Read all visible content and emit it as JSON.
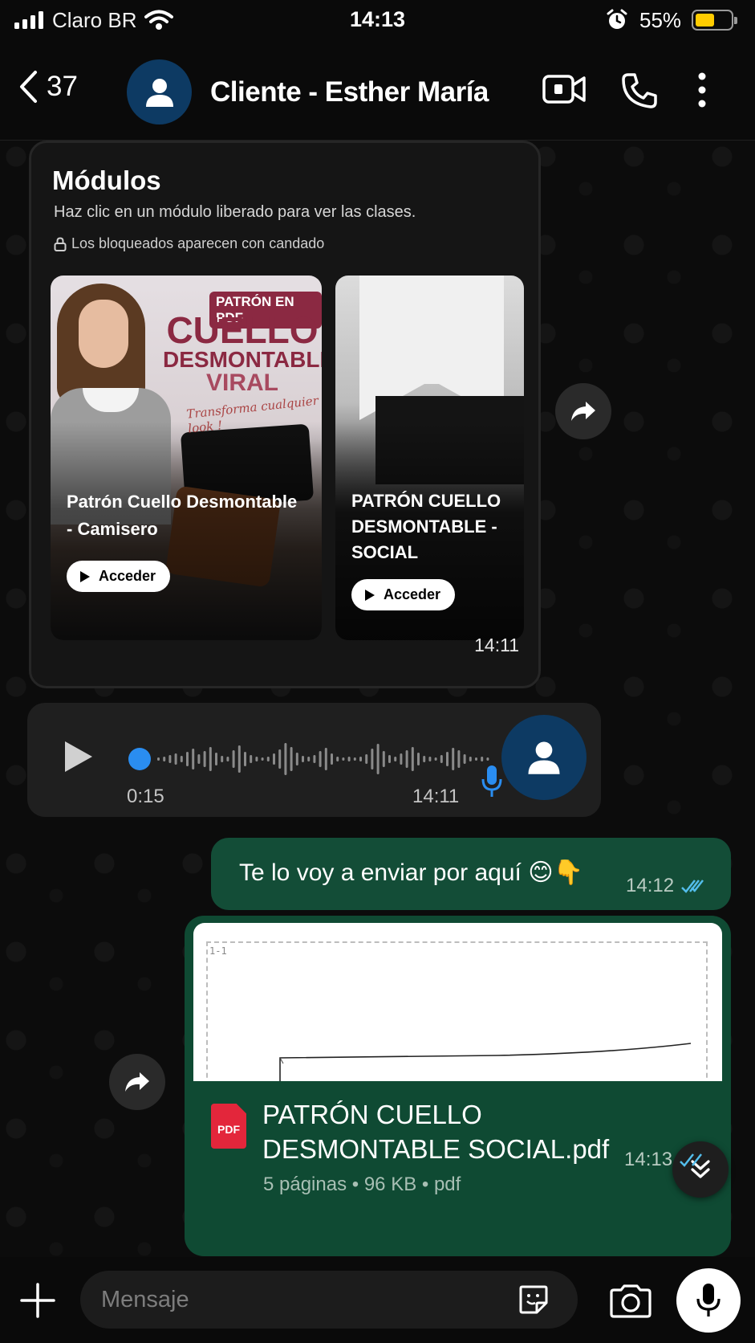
{
  "status_bar": {
    "carrier": "Claro BR",
    "time": "14:13",
    "battery": "55%"
  },
  "header": {
    "back_count": "37",
    "contact_name": "Cliente - Esther María"
  },
  "module_card": {
    "title": "Módulos",
    "subtitle": "Haz clic en un módulo liberado para ver las clases.",
    "lock_note": "Los bloqueados aparecen con candado",
    "promo": {
      "badge": "PATRÓN EN PDF",
      "line1": "CUELLO",
      "line2": "DESMONTABLE",
      "line3": "VIRAL",
      "script": "Transforma cualquier look !"
    },
    "modules": [
      {
        "label": "Patrón Cuello Desmontable - Camisero",
        "button": "Acceder"
      },
      {
        "label": "PATRÓN CUELLO DESMONTABLE - SOCIAL",
        "button": "Acceder"
      }
    ],
    "time": "14:11"
  },
  "voice_message": {
    "duration": "0:15",
    "time": "14:11",
    "progress": 0.0
  },
  "outgoing_text": {
    "text": "Te lo voy a enviar por aquí 😊👇",
    "time": "14:12"
  },
  "document": {
    "preview_mark": "1-1",
    "icon_label": "PDF",
    "filename": "PATRÓN CUELLO DESMONTABLE SOCIAL.pdf",
    "meta": "5 páginas • 96 KB • pdf",
    "time": "14:13"
  },
  "input_bar": {
    "placeholder": "Mensaje"
  },
  "colors": {
    "outgoing_bubble": "#134d37",
    "incoming_bubble": "#1f1f1f",
    "read_ticks": "#53bdeb",
    "avatar": "#0d3a63",
    "battery": "#ffcc00",
    "pdf_icon": "#e3263b"
  }
}
